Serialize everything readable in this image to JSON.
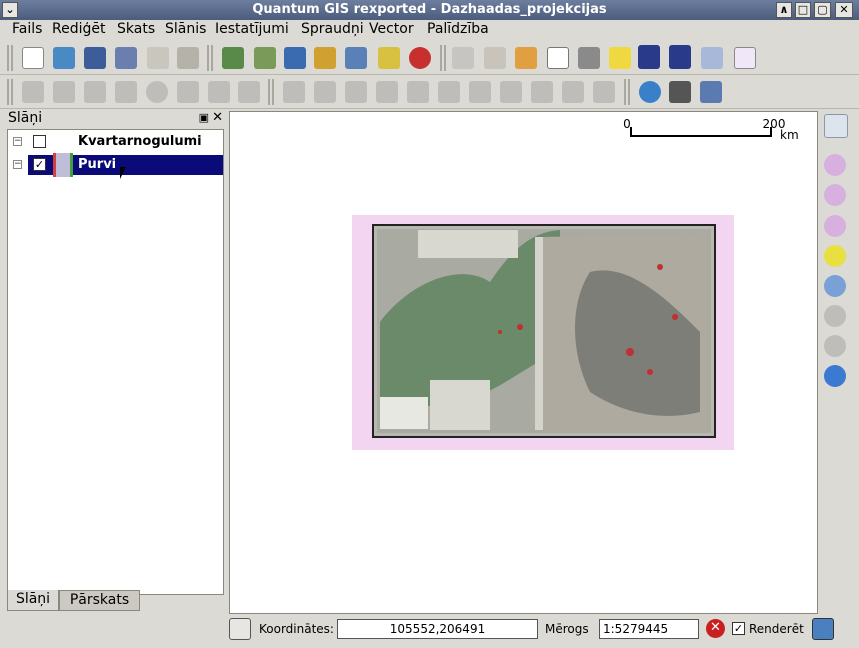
{
  "window": {
    "title": "Quantum GIS rexported - Dazhaadas_projekcijas",
    "menu_icon": "chevron-down-icon",
    "btn_min": "∧",
    "btn_max": "□",
    "btn_close": "✕"
  },
  "menu": [
    "Fails",
    "Rediģēt",
    "Skats",
    "Slānis",
    "Iestatījumi",
    "Spraudņi",
    "Vector",
    "Palīdzība"
  ],
  "layers_panel": {
    "title": "Slāņi",
    "layers": [
      {
        "name": "Kvartarnogulumi",
        "checked": false,
        "check_glyph": ""
      },
      {
        "name": "Purvi",
        "checked": true,
        "check_glyph": "✓"
      }
    ],
    "tabs": [
      "Slāņi",
      "Pārskats"
    ]
  },
  "scale_bar": {
    "start": "0",
    "end": "200",
    "unit": "km"
  },
  "status": {
    "coords_label": "Koordinātes:",
    "coords_value": "105552,206491",
    "scale_label": "Mērogs",
    "scale_value": "1:5279445",
    "render_label": "Renderēt",
    "render_checked": true
  },
  "colors": {
    "title_bar": "#5a6b8b",
    "selection": "#0a0a78",
    "map_pink": "#f3d4f1"
  }
}
